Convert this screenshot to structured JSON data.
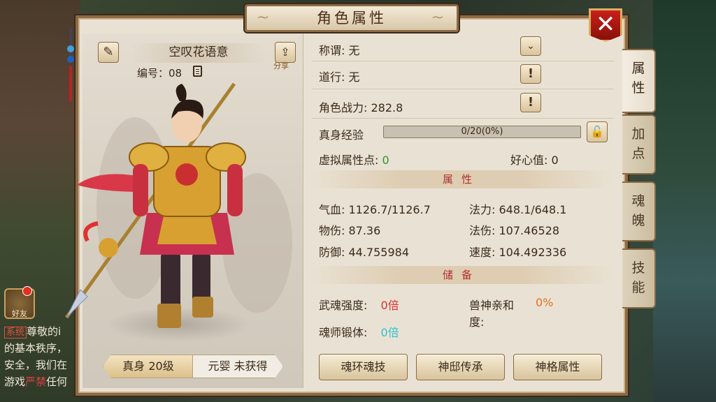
{
  "window": {
    "title": "角色属性",
    "close_label": "✕"
  },
  "character": {
    "name": "空叹花语意",
    "id_label": "编号：08",
    "share_label": "分享",
    "forms": [
      {
        "label": "真身 20级",
        "active": true
      },
      {
        "label": "元婴 未获得",
        "active": false
      }
    ]
  },
  "profile": {
    "title_label": "称谓: 无",
    "daoxing_label": "道行: 无",
    "power_label": "角色战力: 282.8",
    "exp_label": "真身经验",
    "exp_text": "0/20(0%)",
    "exp_progress": 0,
    "virtual_points_label": "虚拟属性点:",
    "virtual_points_value": "0",
    "goodwill_label": "好心值: 0"
  },
  "attributes": {
    "header": "属性",
    "items": [
      {
        "label": "气血: 1126.7/1126.7"
      },
      {
        "label": "法力: 648.1/648.1"
      },
      {
        "label": "物伤: 87.36"
      },
      {
        "label": "法伤: 107.46528"
      },
      {
        "label": "防御: 44.755984"
      },
      {
        "label": "速度: 104.492336"
      }
    ]
  },
  "reserve": {
    "header": "储备",
    "wuhun_label": "武魂强度:",
    "wuhun_value": "0倍",
    "beast_label": "兽神亲和",
    "beast_label2": "度:",
    "beast_value": "0%",
    "forge_label": "魂师锻体:",
    "forge_value": "0倍"
  },
  "actions": [
    "魂环魂技",
    "神邸传承",
    "神格属性"
  ],
  "side_tabs": [
    {
      "label": "属\n性",
      "active": true
    },
    {
      "label": "加\n点",
      "active": false
    },
    {
      "label": "魂\n魄",
      "active": false
    },
    {
      "label": "技\n能",
      "active": false
    }
  ],
  "chat": {
    "friend_label": "好友",
    "system_tag": "系统",
    "line1": "尊敬的i",
    "line2": "的基本秩序，",
    "line3": "安全，我们在",
    "line4_a": "游戏",
    "line4_red": "严禁",
    "line4_b": "任何"
  },
  "colors": {
    "accent_red": "#e03030",
    "frame": "#8c6a44",
    "green": "#2a9a2a",
    "cyan": "#30c0d0"
  }
}
